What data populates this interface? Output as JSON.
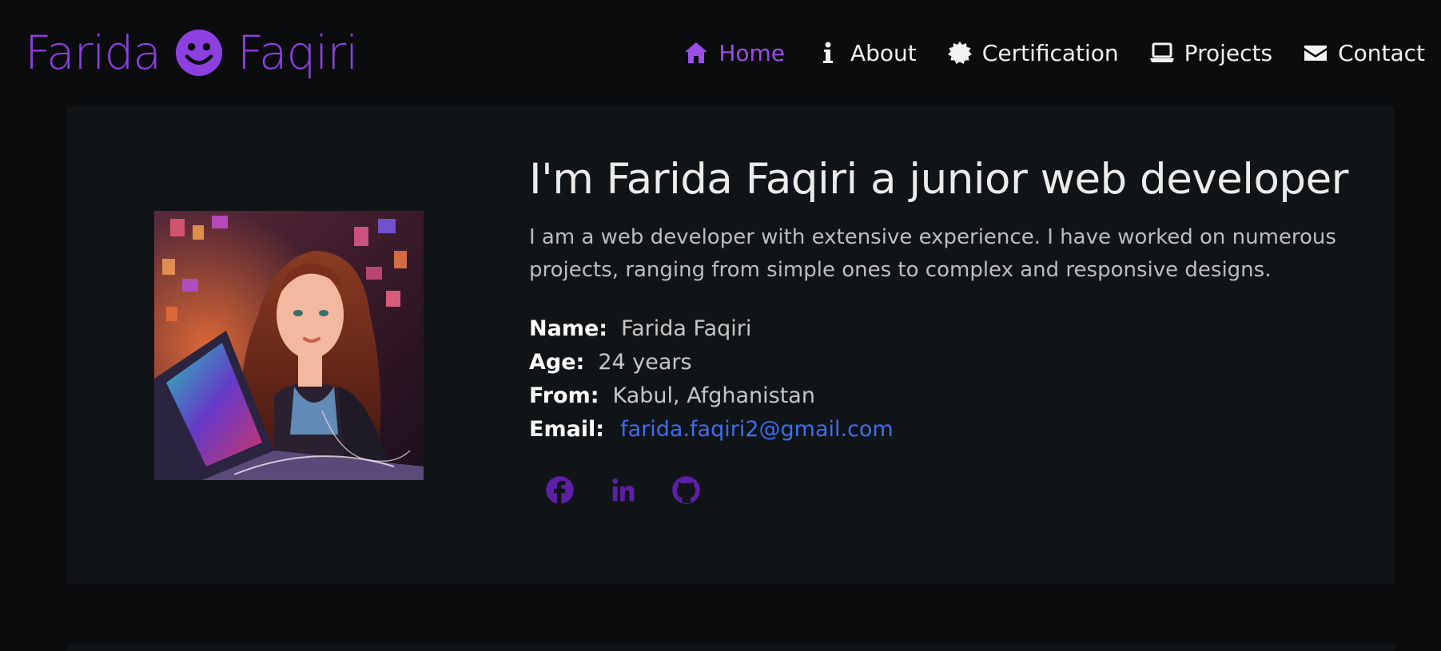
{
  "brand": {
    "first": "Farida",
    "last": "Faqiri",
    "icon": "smiley-face-icon",
    "color": "#8e3fe0"
  },
  "nav": {
    "items": [
      {
        "label": "Home",
        "icon": "home-icon",
        "active": true
      },
      {
        "label": "About",
        "icon": "info-icon",
        "active": false
      },
      {
        "label": "Certification",
        "icon": "certificate-badge-icon",
        "active": false
      },
      {
        "label": "Projects",
        "icon": "laptop-icon",
        "active": false
      },
      {
        "label": "Contact",
        "icon": "envelope-icon",
        "active": false
      }
    ],
    "active_color": "#9a4ee8"
  },
  "hero": {
    "title": "I'm Farida Faqiri a junior web developer",
    "lead": "I am a web developer with extensive experience. I have worked on numerous projects, ranging from simple ones to complex and responsive designs.",
    "details": [
      {
        "key": "Name:",
        "value": "Farida Faqiri"
      },
      {
        "key": "Age:",
        "value": "24 years"
      },
      {
        "key": "From:",
        "value": "Kabul, Afghanistan"
      },
      {
        "key": "Email:",
        "value": "farida.faqiri2@gmail.com",
        "is_link": true
      }
    ],
    "link_color": "#3d6df2",
    "photo": "profile-photo-illustration",
    "social": [
      {
        "icon": "facebook-icon"
      },
      {
        "icon": "linkedin-icon"
      },
      {
        "icon": "github-icon"
      }
    ],
    "social_color": "#5c1fa6"
  }
}
